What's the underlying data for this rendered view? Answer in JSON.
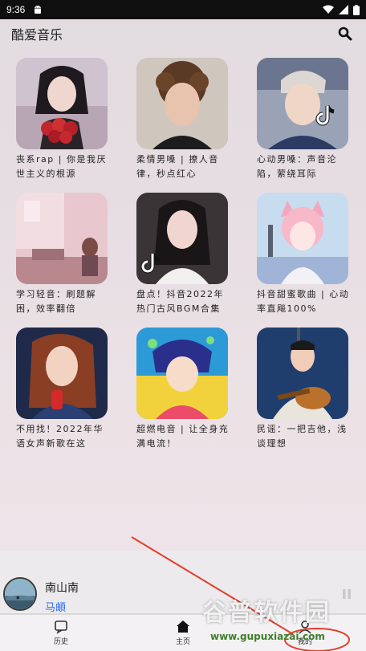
{
  "status_bar": {
    "time": "9:36"
  },
  "app": {
    "title": "酷爱音乐"
  },
  "playlists": [
    {
      "title": "丧系rap | 你是我厌世主义的根源"
    },
    {
      "title": "柔情男嗓 | 撩人音律，秒点红心"
    },
    {
      "title": "心动男嗓：声音沦陷，萦绕耳际"
    },
    {
      "title": "学习轻音：刷题解困，效率翻倍"
    },
    {
      "title": "盘点！抖音2022年热门古风BGM合集"
    },
    {
      "title": "抖音甜蜜歌曲 | 心动率直飚100%"
    },
    {
      "title": "不用找！2022年华语女声新歌在这"
    },
    {
      "title": "超燃电音 | 让全身充满电流！"
    },
    {
      "title": "民谣：一把吉他，浅谈理想"
    }
  ],
  "player": {
    "song": "南山南",
    "artist": "马頔",
    "progress": 0
  },
  "nav": {
    "history": "历史",
    "home": "主页",
    "mine": "我的"
  },
  "watermark": {
    "text": "谷普软件园",
    "url": "www.gupuxiazai.com"
  },
  "icons": {
    "search": "search-icon",
    "history": "history-icon",
    "home": "home-icon",
    "mine": "user-icon",
    "pause": "pause-icon"
  },
  "colors": {
    "accent": "#2f6df6",
    "status_bar": "#0f0f10",
    "annotation_arrow": "#e0402a"
  }
}
